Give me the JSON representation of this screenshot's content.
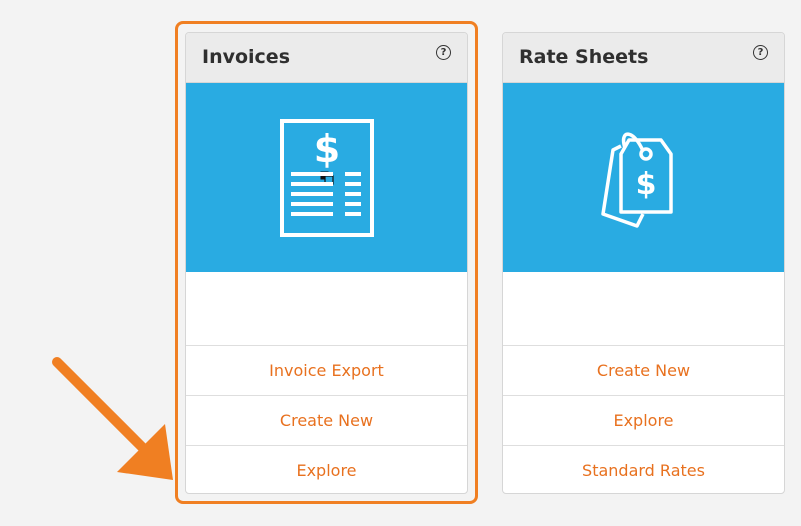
{
  "cards": [
    {
      "title": "Invoices",
      "help_icon": "help-circle-icon",
      "banner_icon": "invoice-document-icon",
      "links": [
        "Invoice Export",
        "Create New",
        "Explore"
      ]
    },
    {
      "title": "Rate Sheets",
      "help_icon": "help-circle-icon",
      "banner_icon": "price-tag-icon",
      "links": [
        "Create New",
        "Explore",
        "Standard Rates"
      ]
    }
  ],
  "colors": {
    "banner": "#29abe2",
    "link": "#e8711f",
    "highlight": "#f07f22",
    "header": "#ebebeb"
  },
  "annotation": {
    "highlight": "orange-highlight-border",
    "arrow": "orange-arrow-pointing-to-explore"
  }
}
